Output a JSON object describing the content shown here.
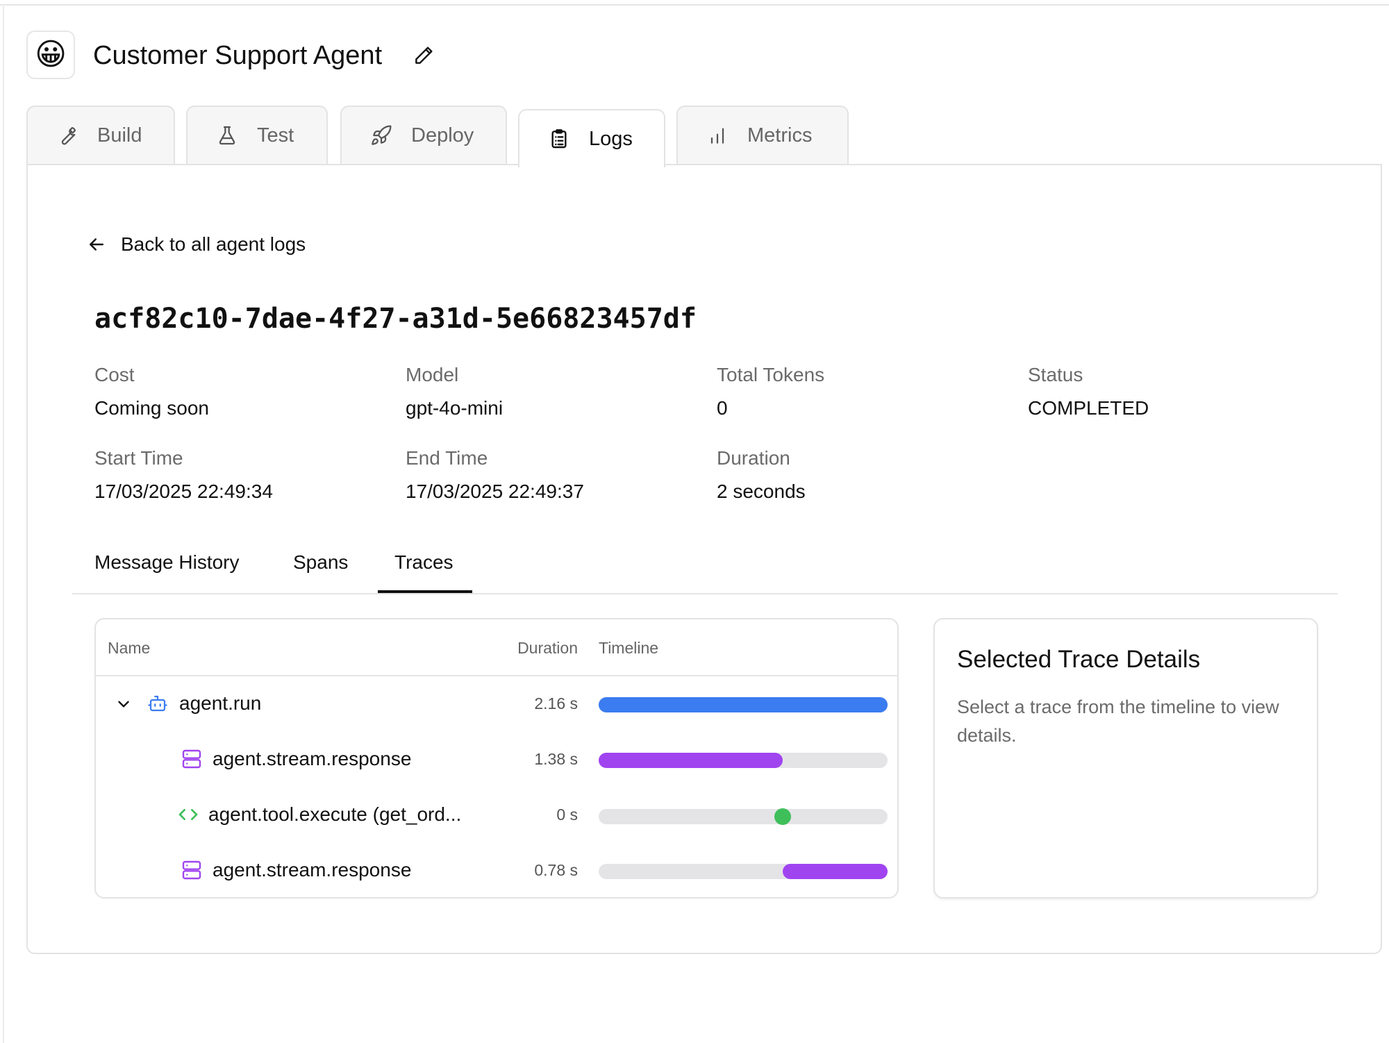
{
  "header": {
    "avatar_emoji": "😀",
    "title": "Customer Support Agent",
    "edit_icon": "pencil-icon"
  },
  "tabs": [
    {
      "label": "Build",
      "icon": "wrench-icon",
      "active": false
    },
    {
      "label": "Test",
      "icon": "flask-icon",
      "active": false
    },
    {
      "label": "Deploy",
      "icon": "rocket-icon",
      "active": false
    },
    {
      "label": "Logs",
      "icon": "clipboard-icon",
      "active": true
    },
    {
      "label": "Metrics",
      "icon": "bar-chart-icon",
      "active": false
    }
  ],
  "log": {
    "back_label": "Back to all agent logs",
    "id": "acf82c10-7dae-4f27-a31d-5e66823457df",
    "meta": {
      "cost": {
        "label": "Cost",
        "value": "Coming soon"
      },
      "model": {
        "label": "Model",
        "value": "gpt-4o-mini"
      },
      "total_tokens": {
        "label": "Total Tokens",
        "value": "0"
      },
      "status": {
        "label": "Status",
        "value": "COMPLETED"
      },
      "start_time": {
        "label": "Start Time",
        "value": "17/03/2025 22:49:34"
      },
      "end_time": {
        "label": "End Time",
        "value": "17/03/2025 22:49:37"
      },
      "duration": {
        "label": "Duration",
        "value": "2 seconds"
      }
    }
  },
  "subtabs": [
    {
      "label": "Message History",
      "active": false
    },
    {
      "label": "Spans",
      "active": false
    },
    {
      "label": "Traces",
      "active": true
    }
  ],
  "traces": {
    "columns": {
      "name": "Name",
      "duration": "Duration",
      "timeline": "Timeline"
    },
    "rows": [
      {
        "name": "agent.run",
        "duration": "2.16 s",
        "icon": "bot-icon",
        "expanded": true,
        "start": 0.0,
        "end": 1.0,
        "color": "#3b7cf0"
      },
      {
        "name": "agent.stream.response",
        "duration": "1.38 s",
        "icon": "server-icon",
        "start": 0.0,
        "end": 0.636,
        "color": "#a044f0"
      },
      {
        "name": "agent.tool.execute (get_ord...",
        "duration": "0 s",
        "icon": "code-icon",
        "start": 0.636,
        "end": 0.636,
        "color": "#3fbf5a"
      },
      {
        "name": "agent.stream.response",
        "duration": "0.78 s",
        "icon": "server-icon",
        "start": 0.636,
        "end": 1.0,
        "color": "#a044f0"
      }
    ]
  },
  "details": {
    "title": "Selected Trace Details",
    "text": "Select a trace from the timeline to view details."
  }
}
